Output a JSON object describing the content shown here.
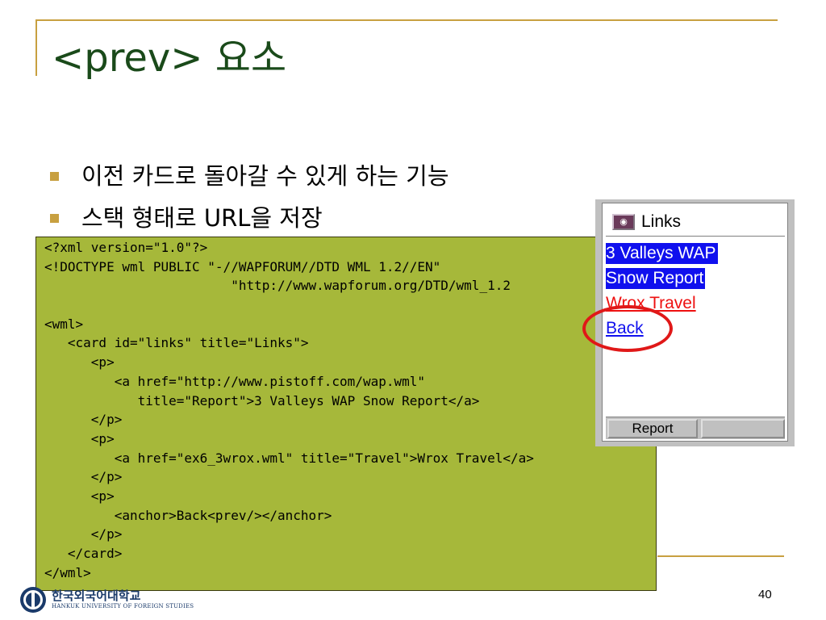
{
  "slide": {
    "title": "<prev> 요소",
    "bullets": [
      "이전 카드로 돌아갈 수 있게 하는 기능",
      "스택 형태로 URL을 저장"
    ],
    "page_number": "40"
  },
  "code": {
    "lines": [
      "<?xml version=\"1.0\"?>",
      "<!DOCTYPE wml PUBLIC \"-//WAPFORUM//DTD WML 1.2//EN\"",
      "                        \"http://www.wapforum.org/DTD/wml_1.2",
      "",
      "<wml>",
      "   <card id=\"links\" title=\"Links\">",
      "      <p>",
      "         <a href=\"http://www.pistoff.com/wap.wml\"",
      "            title=\"Report\">3 Valleys WAP Snow Report</a>",
      "      </p>",
      "      <p>",
      "         <a href=\"ex6_3wrox.wml\" title=\"Travel\">Wrox Travel</a>",
      "      </p>",
      "      <p>",
      "         <anchor>Back<prev/></anchor>",
      "      </p>",
      "   </card>",
      "</wml>"
    ]
  },
  "phone": {
    "card_title": "Links",
    "links": [
      "3 Valleys WAP",
      "Snow Report",
      "Wrox Travel",
      "Back"
    ],
    "softkey_left": "Report",
    "softkey_right": ""
  },
  "logo": {
    "name": "한국외국어대학교",
    "subtitle": "HANKUK UNIVERSITY OF FOREIGN STUDIES"
  },
  "colors": {
    "accent": "#c8a040",
    "title": "#1a4a1a",
    "code_background": "#a6b83a",
    "link_selected_bg": "#1010ee",
    "link_red": "#ee1010",
    "highlight": "#e01818"
  }
}
